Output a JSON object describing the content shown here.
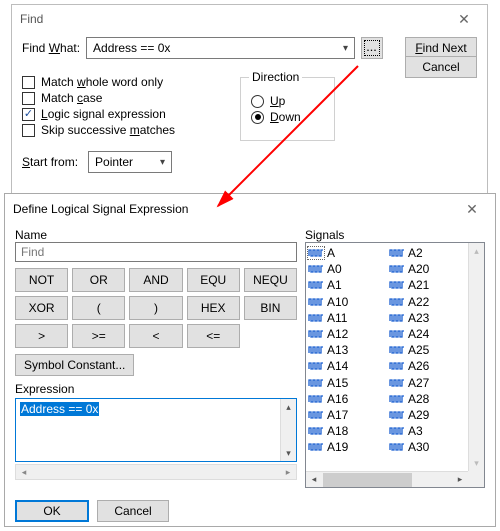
{
  "find_dialog": {
    "title": "Find",
    "find_what_label_pre": "Find ",
    "find_what_label_u": "W",
    "find_what_label_post": "hat:",
    "find_what_value": "Address == 0x",
    "ellipsis": "...",
    "find_next_pre": "",
    "find_next_u": "F",
    "find_next_post": "ind Next",
    "cancel": "Cancel",
    "match_whole_pre": "Match ",
    "match_whole_u": "w",
    "match_whole_post": "hole word only",
    "match_case_pre": "Match ",
    "match_case_u": "c",
    "match_case_post": "ase",
    "logic_pre": "",
    "logic_u": "L",
    "logic_post": "ogic signal expression",
    "skip_pre": "Skip successive ",
    "skip_u": "m",
    "skip_post": "atches",
    "direction_label": "Direction",
    "up_u": "U",
    "up_post": "p",
    "down_u": "D",
    "down_post": "own",
    "start_from_pre": "",
    "start_from_u": "S",
    "start_from_post": "tart from:",
    "start_from_value": "Pointer"
  },
  "expr_dialog": {
    "title": "Define Logical Signal Expression",
    "name_label": "Name",
    "name_value": "Find",
    "ops": {
      "not": "NOT",
      "or": "OR",
      "and": "AND",
      "equ": "EQU",
      "nequ": "NEQU",
      "xor": "XOR",
      "lpar": "(",
      "rpar": ")",
      "hex": "HEX",
      "bin": "BIN",
      "gt": ">",
      "gte": ">=",
      "lt": "<",
      "lte": "<="
    },
    "symbol_constant": "Symbol Constant...",
    "expression_label": "Expression",
    "expression_value": "Address == 0x",
    "signals_label": "Signals",
    "ok": "OK",
    "cancel": "Cancel",
    "signals_col1": [
      "A",
      "A0",
      "A1",
      "A10",
      "A11",
      "A12",
      "A13",
      "A14",
      "A15",
      "A16",
      "A17",
      "A18",
      "A19"
    ],
    "signals_col2": [
      "A2",
      "A20",
      "A21",
      "A22",
      "A23",
      "A24",
      "A25",
      "A26",
      "A27",
      "A28",
      "A29",
      "A3",
      "A30"
    ]
  }
}
